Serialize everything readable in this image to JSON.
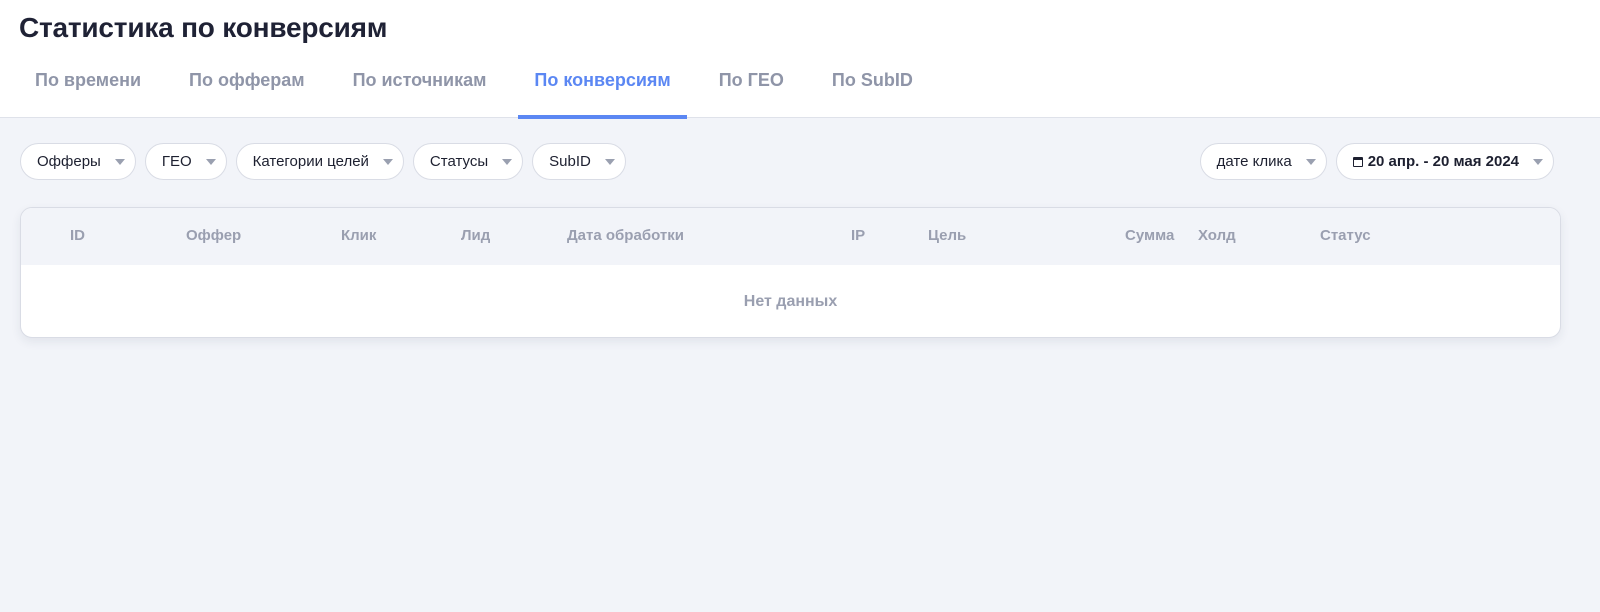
{
  "page": {
    "title": "Статистика по конверсиям"
  },
  "tabs": [
    {
      "label": "По времени",
      "active": false
    },
    {
      "label": "По офферам",
      "active": false
    },
    {
      "label": "По источникам",
      "active": false
    },
    {
      "label": "По конверсиям",
      "active": true
    },
    {
      "label": "По ГЕО",
      "active": false
    },
    {
      "label": "По SubID",
      "active": false
    }
  ],
  "filters": {
    "offers": "Офферы",
    "geo": "ГЕО",
    "goal_categories": "Категории целей",
    "statuses": "Статусы",
    "subid": "SubID"
  },
  "date_filter": {
    "mode": "дате клика",
    "range": "20 апр. - 20 мая 2024"
  },
  "table": {
    "columns": [
      "ID",
      "Оффер",
      "Клик",
      "Лид",
      "Дата обработки",
      "IP",
      "Цель",
      "Сумма",
      "Холд",
      "Статус"
    ],
    "empty_text": "Нет данных"
  },
  "colors": {
    "accent": "#5b87f3",
    "background": "#f2f4f9",
    "muted_text": "#9a9fb0"
  }
}
